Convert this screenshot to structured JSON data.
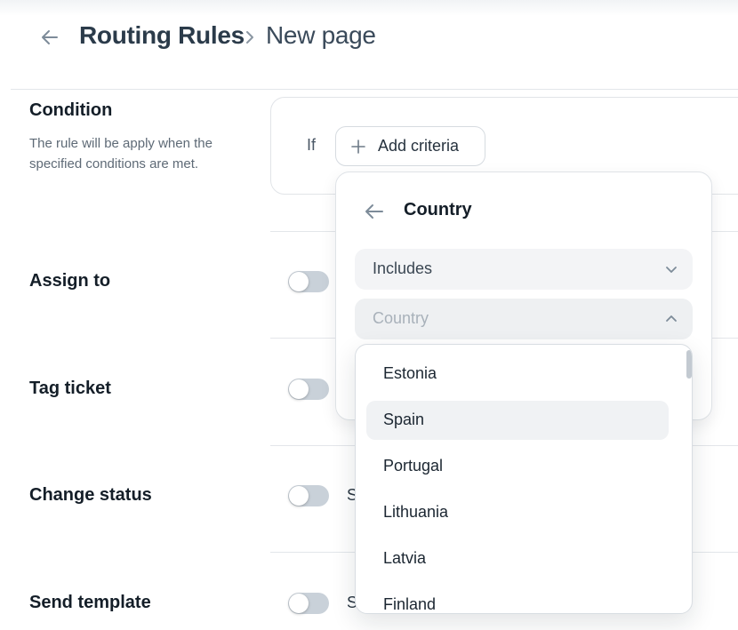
{
  "header": {
    "breadcrumb_parent": "Routing Rules",
    "breadcrumb_current": "New page"
  },
  "sections": {
    "condition": {
      "title": "Condition",
      "description": "The rule will be apply when the specified conditions are met.",
      "if_label": "If",
      "add_criteria_label": "Add criteria"
    },
    "assign_to": {
      "title": "Assign to"
    },
    "tag_ticket": {
      "title": "Tag ticket"
    },
    "change_status": {
      "title": "Change status",
      "partial_text": "S"
    },
    "send_template": {
      "title": "Send template",
      "partial_text": "S"
    }
  },
  "popover": {
    "title": "Country",
    "operator_value": "Includes",
    "country_placeholder": "Country",
    "options": [
      "Estonia",
      "Spain",
      "Portugal",
      "Lithuania",
      "Latvia",
      "Finland"
    ],
    "hovered_option": "Spain"
  },
  "colors": {
    "toggle_off": "#c9d1d9",
    "hover_bg": "#f0f2f4",
    "field_bg": "#f3f4f6",
    "border": "#dfe3e7"
  },
  "icons": {
    "back": "arrow-left-icon",
    "breadcrumb_separator": "chevron-right-icon",
    "add": "plus-icon",
    "dropdown_closed": "chevron-down-icon",
    "dropdown_open": "chevron-up-icon"
  }
}
